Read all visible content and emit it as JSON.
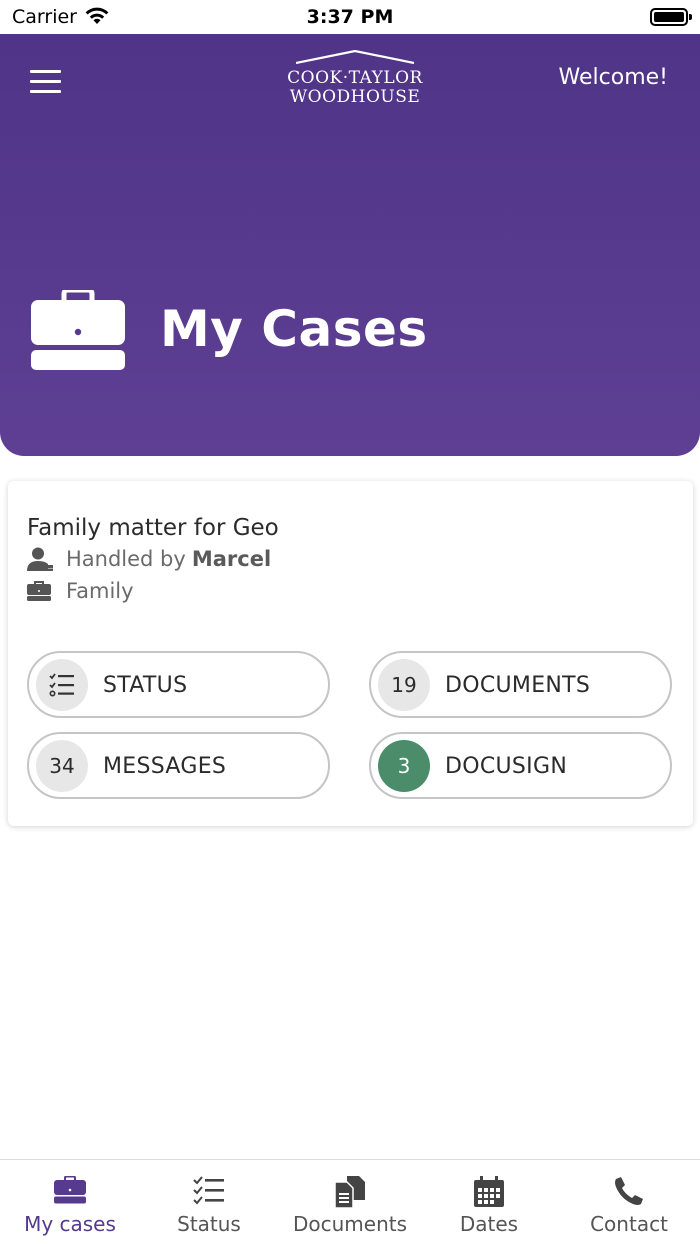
{
  "status_bar": {
    "carrier": "Carrier",
    "time": "3:37 PM"
  },
  "header": {
    "logo_line1": "COOK·TAYLOR",
    "logo_line2": "WOODHOUSE",
    "welcome": "Welcome!",
    "title": "My Cases",
    "background_color": "#553a8e"
  },
  "case": {
    "title": "Family matter for Geo",
    "handled_prefix": "Handled by",
    "handler": "Marcel",
    "category": "Family",
    "buttons": [
      {
        "label": "STATUS",
        "icon": "status-list-icon"
      },
      {
        "label": "DOCUMENTS",
        "count": "19"
      },
      {
        "label": "MESSAGES",
        "count": "34"
      },
      {
        "label": "DOCUSIGN",
        "count": "3",
        "badge_color": "#4b8c6b"
      }
    ]
  },
  "tabs": [
    {
      "label": "My cases",
      "icon": "briefcase-icon",
      "active": true
    },
    {
      "label": "Status",
      "icon": "checklist-icon"
    },
    {
      "label": "Documents",
      "icon": "documents-icon"
    },
    {
      "label": "Dates",
      "icon": "calendar-icon"
    },
    {
      "label": "Contact",
      "icon": "phone-icon"
    }
  ],
  "colors": {
    "accent": "#553a8e",
    "docusign_badge": "#4b8c6b"
  }
}
